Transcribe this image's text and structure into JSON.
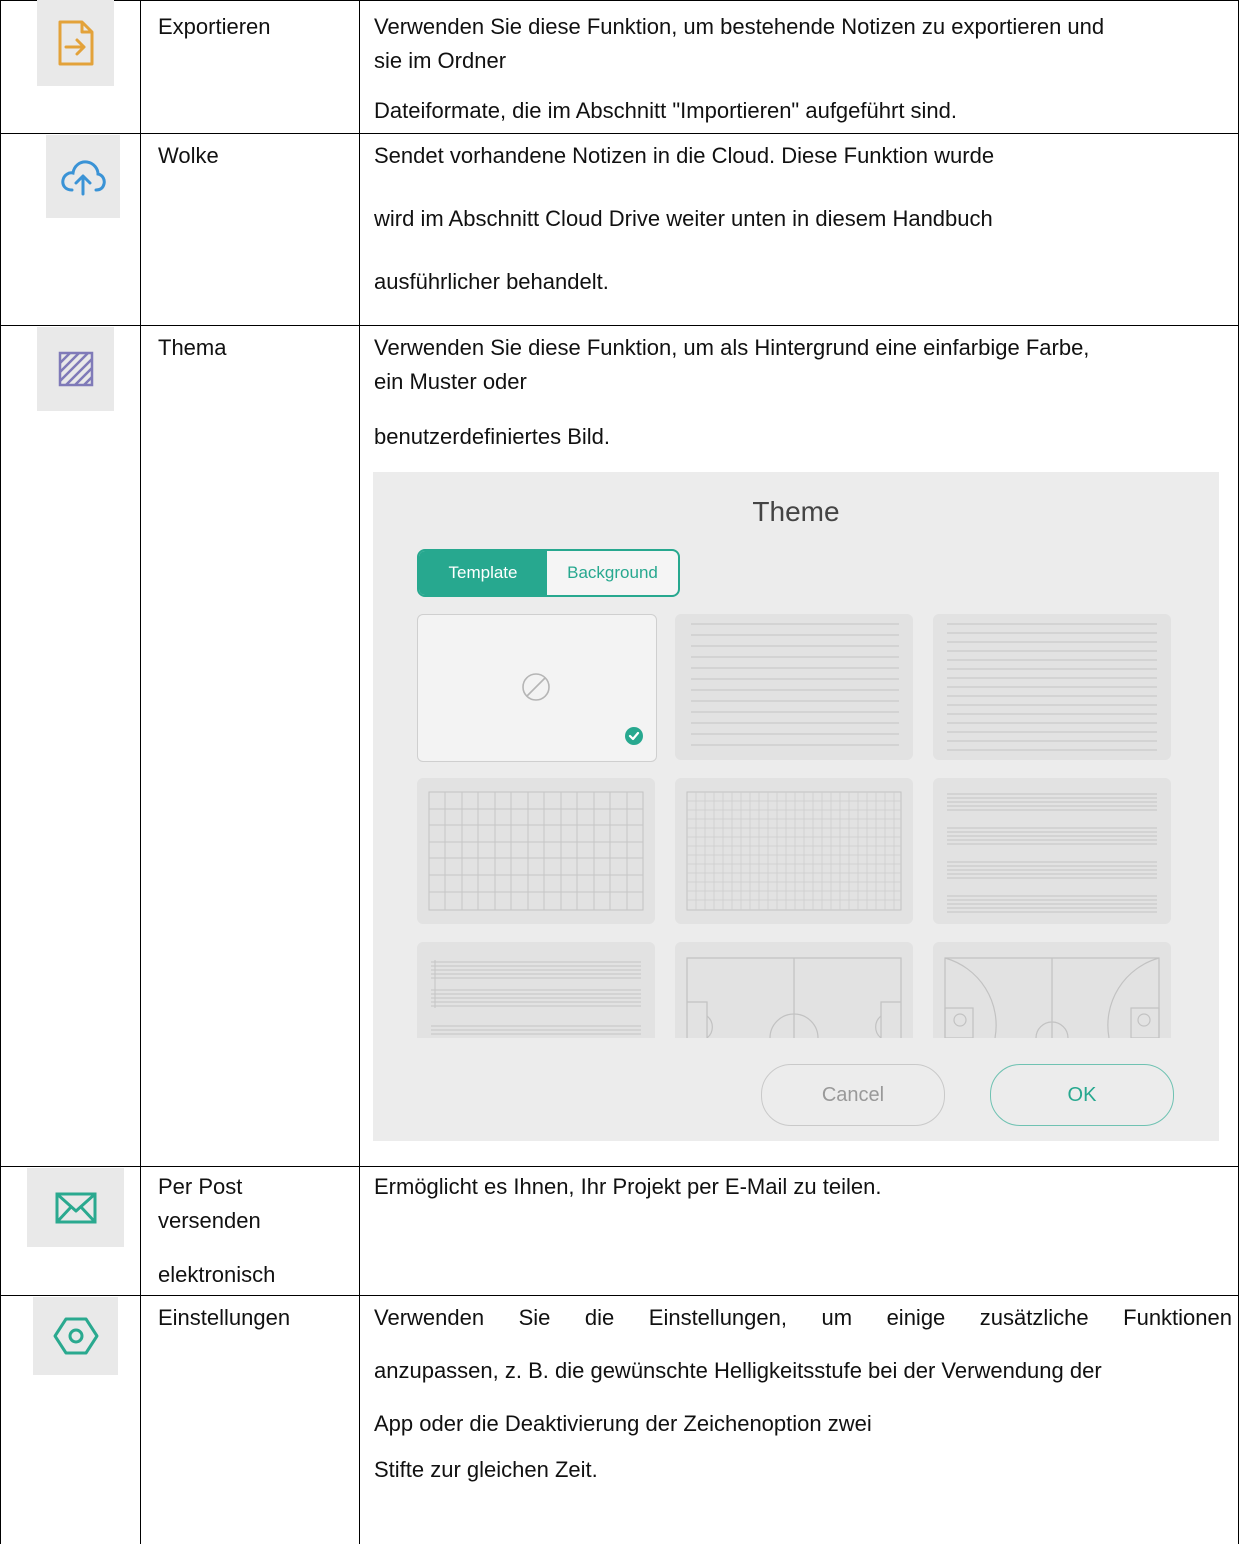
{
  "rows": [
    {
      "icon": "export-file-icon",
      "name_lines": [
        "Exportieren"
      ],
      "desc_lines": [
        "Verwenden Sie diese Funktion, um bestehende Notizen zu exportieren und",
        "sie im Ordner",
        "Dateiformate, die im Abschnitt \"Importieren\" aufgeführt sind."
      ]
    },
    {
      "icon": "cloud-upload-icon",
      "name_lines": [
        "Wolke"
      ],
      "desc_lines": [
        "Sendet vorhandene Notizen in die Cloud. Diese Funktion wurde",
        "wird im Abschnitt Cloud Drive weiter unten in diesem Handbuch",
        "ausführlicher behandelt."
      ]
    },
    {
      "icon": "theme-pattern-icon",
      "name_lines": [
        "Thema"
      ],
      "desc_lines": [
        "Verwenden Sie diese Funktion, um als Hintergrund eine einfarbige Farbe,",
        "ein Muster oder",
        "benutzerdefiniertes Bild."
      ]
    },
    {
      "icon": "mail-icon",
      "name_lines": [
        "Per Post",
        "versenden",
        "elektronisch"
      ],
      "desc_lines": [
        "Ermöglicht es Ihnen, Ihr Projekt per E-Mail zu teilen."
      ]
    },
    {
      "icon": "settings-hexagon-icon",
      "name_lines": [
        "Einstellungen"
      ],
      "desc_lines": [
        "Verwenden Sie die Einstellungen, um einige zusätzliche Funktionen",
        "anzupassen, z. B. die gewünschte Helligkeitsstufe bei der Verwendung der",
        "App oder die Deaktivierung der Zeichenoption zwei",
        "Stifte zur gleichen Zeit."
      ]
    }
  ],
  "theme_dialog": {
    "title": "Theme",
    "tabs": [
      "Template",
      "Background"
    ],
    "active_tab": "Template",
    "cancel_label": "Cancel",
    "ok_label": "OK"
  },
  "colors": {
    "accent": "#27a88f",
    "export_icon": "#e3a23a",
    "cloud_icon": "#3a93d6",
    "theme_icon": "#7f7ab8",
    "mail_icon": "#2aa98f",
    "settings_icon": "#2aa98f"
  }
}
